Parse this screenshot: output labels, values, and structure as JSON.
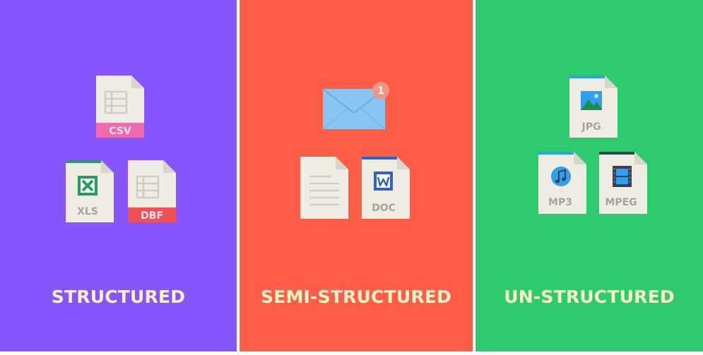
{
  "colors": {
    "structured_bg": "#8755FD",
    "semi_structured_bg": "#FE5E48",
    "unstructured_bg": "#2ECA6E",
    "title_text": "#FAF3C6",
    "paper": "#EFECE3",
    "paper_fold": "#D8D5CB",
    "label_text": "#A7A49D",
    "csv_band": "#F06AAD",
    "dbf_band": "#EE5057",
    "xls_accent": "#20A05A",
    "doc_accent": "#2E66C8",
    "jpg_accent": "#2DA0F0",
    "mp3_accent": "#2DA0F0",
    "mpeg_accent": "#3A3E4E",
    "envelope": "#8AC4F2",
    "badge": "#F79483"
  },
  "panels": [
    {
      "title": "STRUCTURED",
      "icons": [
        {
          "name": "csv-file-icon",
          "label": "CSV"
        },
        {
          "name": "xls-file-icon",
          "label": "XLS"
        },
        {
          "name": "dbf-file-icon",
          "label": "DBF"
        }
      ]
    },
    {
      "title": "SEMI-STRUCTURED",
      "icons": [
        {
          "name": "email-envelope-icon",
          "badge": "1"
        },
        {
          "name": "text-document-icon"
        },
        {
          "name": "doc-file-icon",
          "label": "DOC"
        }
      ]
    },
    {
      "title": "UN-STRUCTURED",
      "icons": [
        {
          "name": "jpg-file-icon",
          "label": "JPG"
        },
        {
          "name": "mp3-file-icon",
          "label": "MP3"
        },
        {
          "name": "mpeg-file-icon",
          "label": "MPEG"
        }
      ]
    }
  ]
}
